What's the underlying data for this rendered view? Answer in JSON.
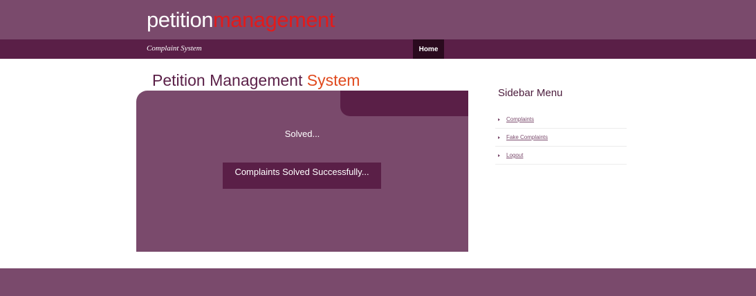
{
  "header": {
    "logo_part1": "petition",
    "logo_part2": "management"
  },
  "navbar": {
    "tagline": "Complaint System",
    "home_label": "Home"
  },
  "main": {
    "title_part1": "Petition Management ",
    "title_part2": "System",
    "status_text": "Solved...",
    "message": "Complaints Solved Successfully..."
  },
  "sidebar": {
    "title": "Sidebar Menu",
    "items": [
      {
        "label": "Complaints"
      },
      {
        "label": "Fake Complaints"
      },
      {
        "label": "Logout"
      }
    ]
  },
  "colors": {
    "header_bg": "#7a4a6c",
    "nav_bg": "#5a1f47",
    "nav_active_bg": "#2a0a1e",
    "logo_accent": "#e21b1b",
    "title_accent": "#e04a1e"
  },
  "icons": {
    "sidebar_bullet": "triangle-right-icon"
  }
}
